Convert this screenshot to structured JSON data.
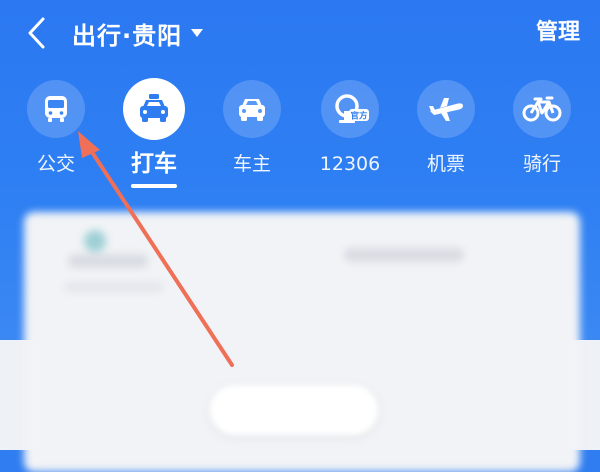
{
  "header": {
    "title": "出行·贵阳",
    "manage_label": "管理"
  },
  "tabs": [
    {
      "label": "公交",
      "icon": "bus-icon",
      "active": false
    },
    {
      "label": "打车",
      "icon": "taxi-icon",
      "active": true
    },
    {
      "label": "车主",
      "icon": "car-icon",
      "active": false
    },
    {
      "label": "12306",
      "icon": "railway-official-icon",
      "active": false
    },
    {
      "label": "机票",
      "icon": "airplane-icon",
      "active": false
    },
    {
      "label": "骑行",
      "icon": "bicycle-icon",
      "active": false
    }
  ],
  "badges": {
    "official": "官方"
  },
  "colors": {
    "brand_blue": "#2f7df0",
    "annotation_arrow": "#ef6f57",
    "white": "#ffffff"
  }
}
